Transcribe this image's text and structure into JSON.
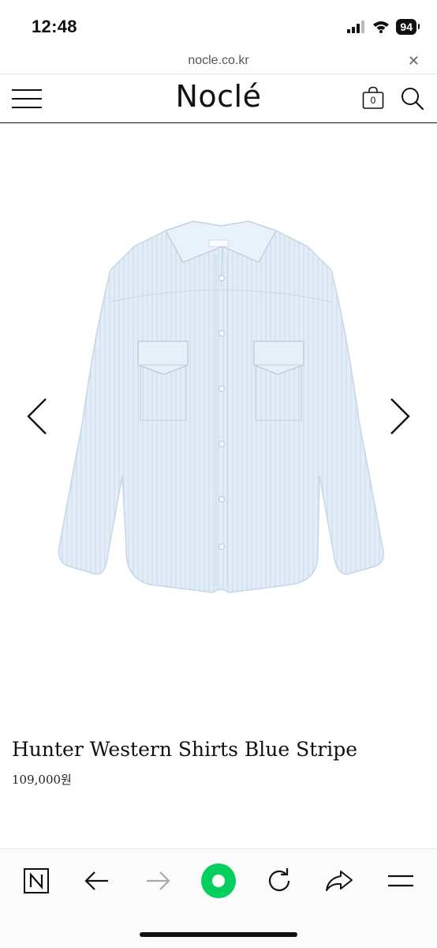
{
  "status_bar": {
    "time": "12:48",
    "battery_level": "94",
    "icons": [
      "cellular-signal-icon",
      "wifi-icon",
      "battery-icon"
    ]
  },
  "browser": {
    "url": "nocle.co.kr",
    "close_icon": "close-icon"
  },
  "site_header": {
    "logo": "Noclé",
    "cart_count": "0",
    "icons": [
      "hamburger-menu-icon",
      "shopping-bag-icon",
      "search-icon"
    ]
  },
  "gallery": {
    "image_description": "shirt-product-image",
    "shirt_color": "#dde9f5",
    "prev_icon": "chevron-left-icon",
    "next_icon": "chevron-right-icon"
  },
  "product": {
    "name": "Hunter Western Shirts Blue Stripe",
    "price": "109,000원"
  },
  "toolbar": {
    "items": [
      "naver-n-icon",
      "back-arrow-icon",
      "forward-arrow-icon",
      "green-home-icon",
      "reload-icon",
      "share-icon",
      "menu-icon"
    ],
    "accent_color": "#03cf5d"
  }
}
